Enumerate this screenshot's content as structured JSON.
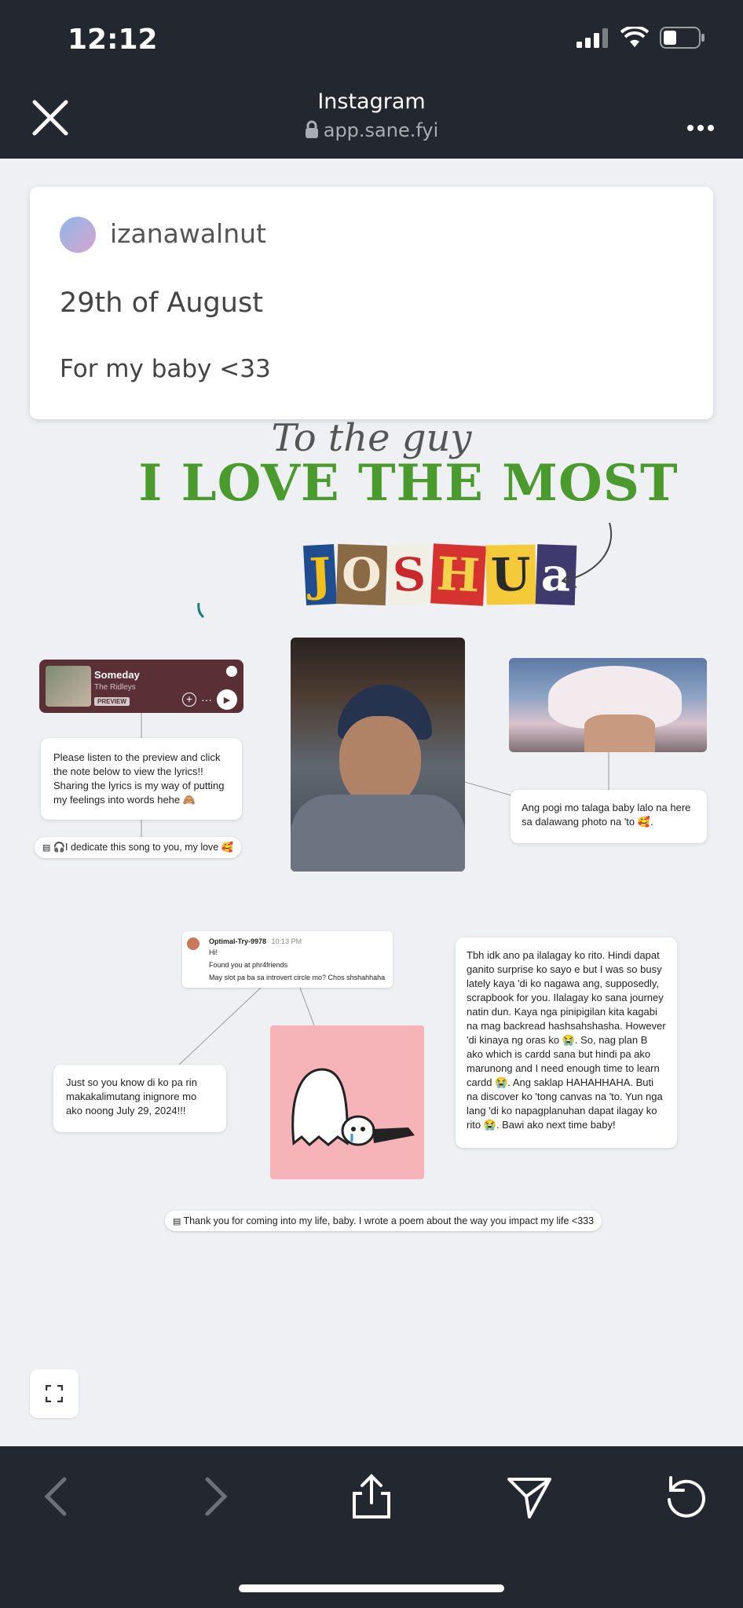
{
  "status": {
    "time": "12:12"
  },
  "navbar": {
    "title": "Instagram",
    "url": "app.sane.fyi"
  },
  "post": {
    "username": "izanawalnut",
    "date": "29th of August",
    "caption": "For my baby <33"
  },
  "heading": {
    "line1": "To the guy",
    "line2": "I LOVE THE MOST",
    "name_letters": [
      "J",
      "O",
      "S",
      "H",
      "U",
      "a"
    ]
  },
  "spotify": {
    "song": "Someday",
    "artist": "The Ridleys",
    "badge": "PREVIEW"
  },
  "notes": {
    "listen": "Please listen to the preview and click the note below to view the lyrics!! Sharing the lyrics is my way of putting my feelings into words hehe 🙈",
    "dedicate": "🎧I dedicate this song to you, my love 🥰",
    "pogi": "Ang pogi mo talaga baby lalo na here sa dalawang photo na 'to 🥰.",
    "tweet_user": "Optimal-Try-9978",
    "tweet_time": "10:13 PM",
    "tweet_line1": "Hi!",
    "tweet_line2": "Found you at phr4friends",
    "tweet_line3": "May slot pa ba sa introvert circle mo? Chos shshahhaha",
    "just_so": "Just so you know di ko pa rin makakalimutang inignore mo ako noong July 29, 2024!!!",
    "tbh": "Tbh idk ano pa ilalagay ko rito. Hindi dapat ganito surprise ko sayo e but I was so busy lately kaya 'di ko nagawa ang, supposedly, scrapbook for you. Ilalagay ko sana journey natin dun. Kaya nga pinipigilan kita kagabi na mag backread hashsahshasha. However 'di kinaya ng oras ko 😭. So, nag plan B ako which is cardd sana but hindi pa ako marunong and I need enough time to learn cardd 😭. Ang saklap HAHAHHAHA. Buti na discover ko 'tong canvas na 'to. Yun nga lang 'di ko napagplanuhan dapat ilagay ko rito 😭. Bawi ako next time baby!",
    "thank_you": "Thank you for coming into my life, baby. I wrote a poem about the way you impact my life <333"
  },
  "colors": {
    "bar": "#23272f",
    "canvas": "#eef0f4",
    "green": "#4a9a2e",
    "spotify": "#5a2f35",
    "sticker": "#f6b4b8"
  },
  "icons": [
    "close-icon",
    "lock-icon",
    "more-icon",
    "signal-icon",
    "wifi-icon",
    "battery-icon",
    "fullscreen-icon",
    "back-icon",
    "forward-icon",
    "share-icon",
    "send-icon",
    "reload-icon"
  ]
}
